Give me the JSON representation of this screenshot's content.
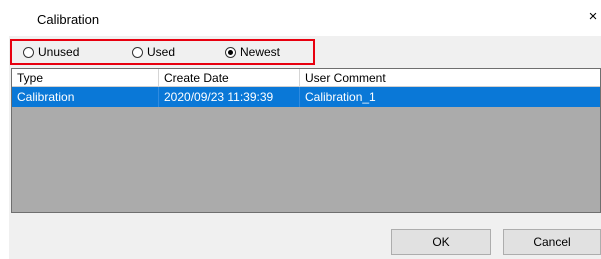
{
  "window": {
    "title": "Calibration",
    "close_glyph": "×"
  },
  "filter": {
    "options": [
      {
        "label": "Unused",
        "checked": false
      },
      {
        "label": "Used",
        "checked": false
      },
      {
        "label": "Newest",
        "checked": true
      }
    ],
    "highlight_color": "#e8000f"
  },
  "table": {
    "columns": [
      "Type",
      "Create Date",
      "User Comment"
    ],
    "rows": [
      {
        "type": "Calibration",
        "create_date": "2020/09/23 11:39:39",
        "user_comment": "Calibration_1",
        "selected": true
      }
    ],
    "selection_color": "#0a78d7"
  },
  "buttons": {
    "ok": "OK",
    "cancel": "Cancel"
  }
}
